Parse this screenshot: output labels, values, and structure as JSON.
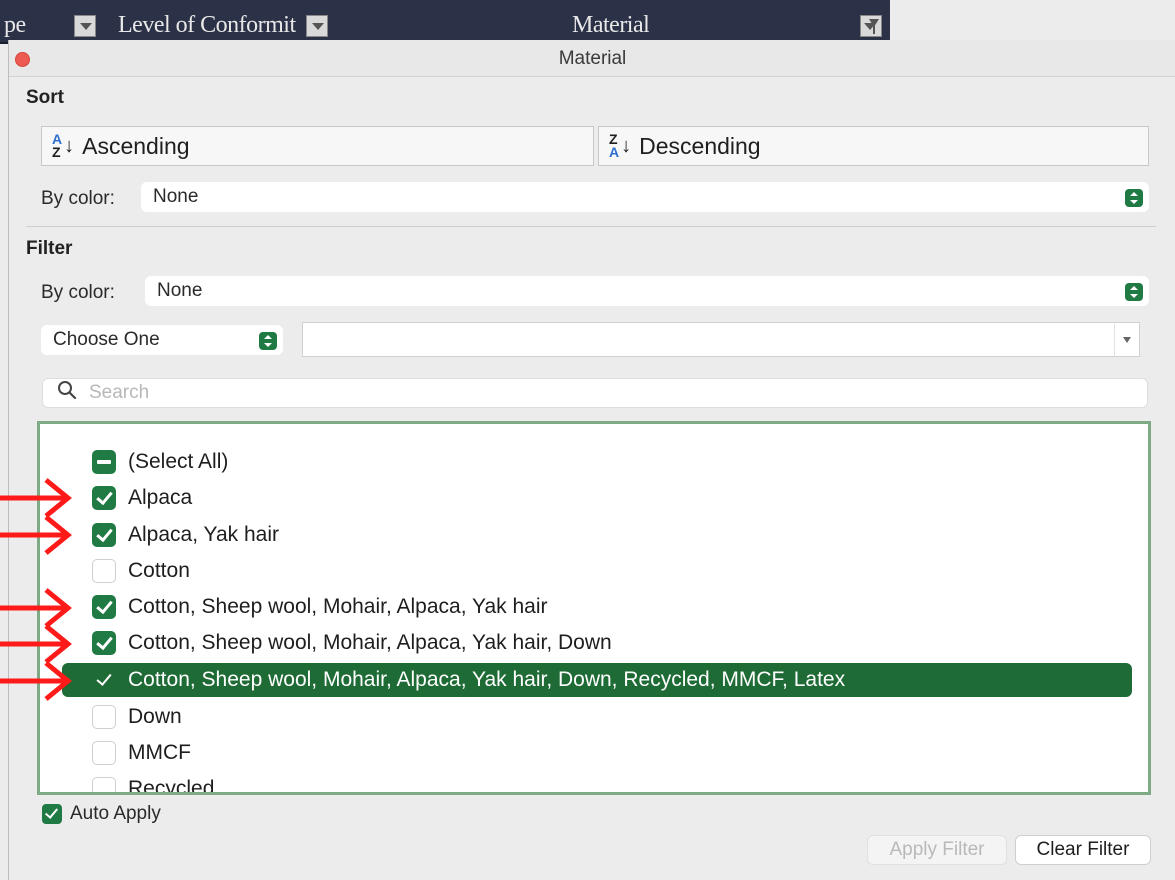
{
  "sheet_header": {
    "col_partial": "pe",
    "col_conformity": "Level of Conformit",
    "col_material": "Material"
  },
  "panel": {
    "title": "Material",
    "sort": {
      "label": "Sort",
      "ascending_label": "Ascending",
      "descending_label": "Descending",
      "by_color_label": "By color:",
      "by_color_value": "None"
    },
    "filter": {
      "label": "Filter",
      "by_color_label": "By color:",
      "by_color_value": "None",
      "condition_value": "Choose One",
      "condition_text": "",
      "search_placeholder": "Search",
      "items": [
        {
          "label": "(Select All)",
          "state": "mixed"
        },
        {
          "label": "Alpaca",
          "state": "checked"
        },
        {
          "label": "Alpaca, Yak hair",
          "state": "checked"
        },
        {
          "label": "Cotton",
          "state": "unchecked"
        },
        {
          "label": "Cotton, Sheep wool, Mohair, Alpaca, Yak hair",
          "state": "checked"
        },
        {
          "label": "Cotton, Sheep wool, Mohair, Alpaca, Yak hair, Down",
          "state": "checked"
        },
        {
          "label": "Cotton, Sheep wool, Mohair, Alpaca, Yak hair, Down, Recycled, MMCF, Latex",
          "state": "checked",
          "selected": true
        },
        {
          "label": "Down",
          "state": "unchecked"
        },
        {
          "label": "MMCF",
          "state": "unchecked"
        },
        {
          "label": "Recycled",
          "state": "unchecked"
        }
      ]
    },
    "auto_apply_label": "Auto Apply",
    "auto_apply_checked": true,
    "apply_filter_label": "Apply Filter",
    "clear_filter_label": "Clear Filter"
  },
  "colors": {
    "accent_green": "#1f7a43",
    "selection_green": "#1f6b36",
    "annotation_red": "#ff1a1a",
    "header_navy": "#2b3147"
  }
}
